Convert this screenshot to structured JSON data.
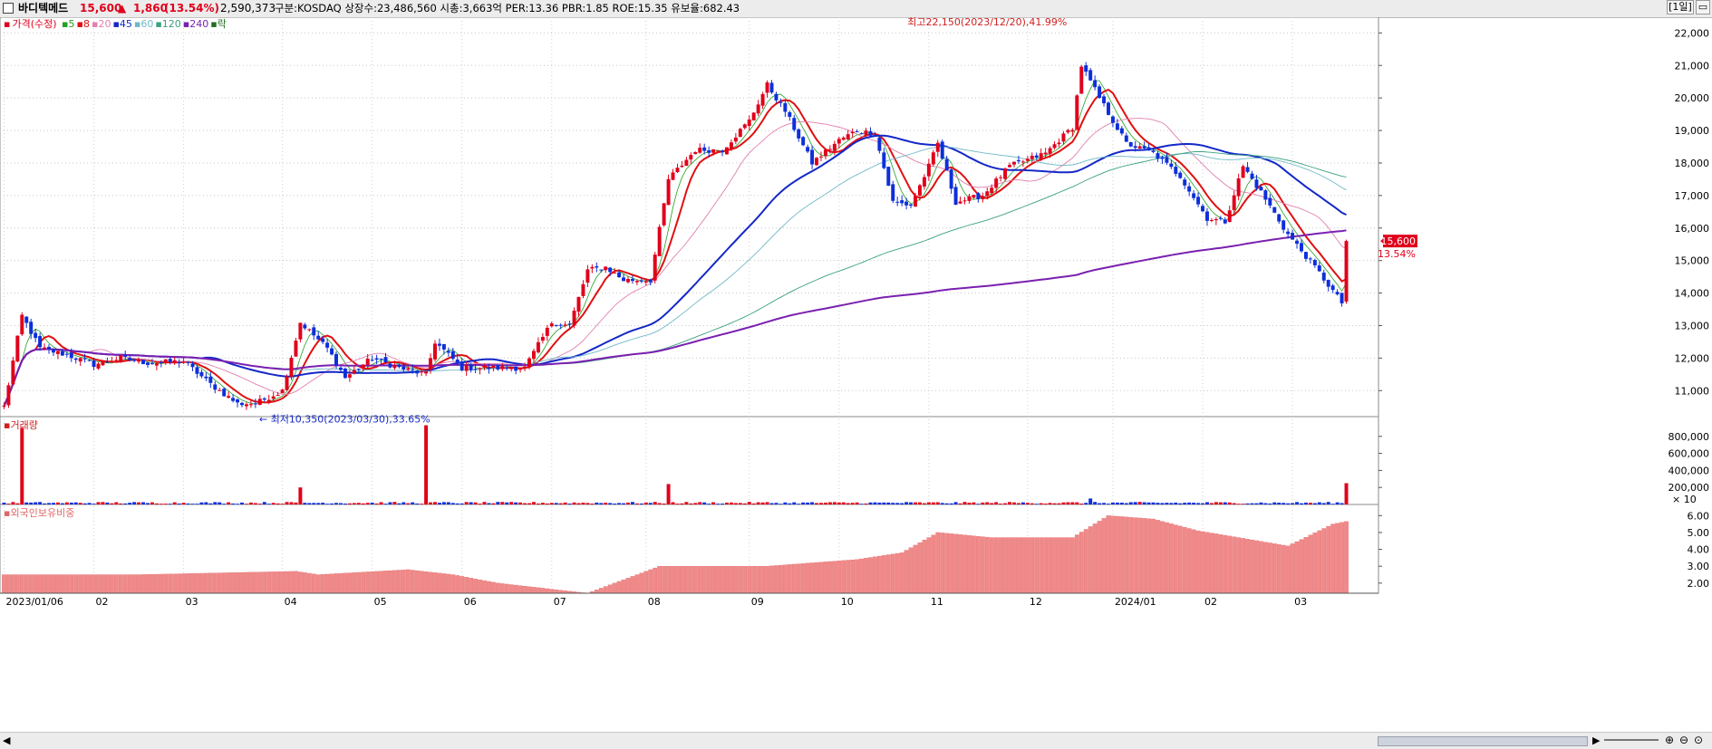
{
  "header": {
    "stock_name": "바디텍메드",
    "price": "15,600",
    "change_arrow": "▲",
    "change": "1,860",
    "change_pct": "(13.54%)",
    "volume": "2,590,373",
    "info": "구분:KOSDAQ 상장수:23,486,560 시총:3,663억 PER:13.36 PBR:1.85 ROE:15.35 유보율:682.43",
    "period_button": "[1일]",
    "up_color": "#e0001b",
    "down_color": "#0d2fd9"
  },
  "legend": {
    "price_label": "가격(수정)",
    "ma": [
      {
        "label": "5",
        "color": "#22a022"
      },
      {
        "label": "8",
        "color": "#e01010"
      },
      {
        "label": "20",
        "color": "#e080b0"
      },
      {
        "label": "45",
        "color": "#1428c8"
      },
      {
        "label": "60",
        "color": "#70b8c8"
      },
      {
        "label": "120",
        "color": "#3aa080"
      },
      {
        "label": "240",
        "color": "#7a20b0"
      },
      {
        "label": "락",
        "color": "#207020"
      }
    ]
  },
  "annotations": {
    "high": "최고22,150(2023/12/20),41.99%",
    "low": "최저10,350(2023/03/30),33.65%"
  },
  "current_price": {
    "label": "15,600",
    "pct": "13.54%"
  },
  "volume_panel": {
    "label": "거래량",
    "unit": "× 10"
  },
  "foreign_panel": {
    "label": "외국인보유비중"
  },
  "chart_data": [
    {
      "type": "candlestick",
      "title": "",
      "y_ticks": [
        "22,000",
        "21,000",
        "20,000",
        "19,000",
        "18,000",
        "17,000",
        "16,000",
        "15,000",
        "14,000",
        "13,000",
        "12,000",
        "11,000"
      ],
      "ylim": [
        10200,
        22400
      ],
      "x_ticks": [
        "2023/01/06",
        "02",
        "03",
        "04",
        "05",
        "06",
        "07",
        "08",
        "09",
        "10",
        "11",
        "12",
        "2024/01",
        "02",
        "03"
      ],
      "x_tick_index": [
        0,
        20,
        40,
        62,
        82,
        102,
        122,
        143,
        166,
        186,
        206,
        228,
        247,
        267,
        287
      ],
      "n_bars": 300,
      "waypoints": [
        [
          0,
          10500
        ],
        [
          4,
          13300
        ],
        [
          8,
          12300
        ],
        [
          14,
          12100
        ],
        [
          20,
          11800
        ],
        [
          26,
          12000
        ],
        [
          32,
          11850
        ],
        [
          40,
          11900
        ],
        [
          46,
          11200
        ],
        [
          52,
          10600
        ],
        [
          56,
          10600
        ],
        [
          62,
          11000
        ],
        [
          66,
          13100
        ],
        [
          72,
          12300
        ],
        [
          76,
          11400
        ],
        [
          82,
          12000
        ],
        [
          88,
          11700
        ],
        [
          94,
          11500
        ],
        [
          96,
          12500
        ],
        [
          102,
          11700
        ],
        [
          110,
          11700
        ],
        [
          116,
          11700
        ],
        [
          122,
          13100
        ],
        [
          126,
          13000
        ],
        [
          130,
          14700
        ],
        [
          134,
          14800
        ],
        [
          138,
          14400
        ],
        [
          144,
          14400
        ],
        [
          148,
          17500
        ],
        [
          154,
          18400
        ],
        [
          160,
          18400
        ],
        [
          166,
          19300
        ],
        [
          170,
          20400
        ],
        [
          174,
          19600
        ],
        [
          180,
          18000
        ],
        [
          186,
          18700
        ],
        [
          190,
          19000
        ],
        [
          194,
          18900
        ],
        [
          198,
          16800
        ],
        [
          202,
          16700
        ],
        [
          206,
          17900
        ],
        [
          208,
          18600
        ],
        [
          212,
          16800
        ],
        [
          218,
          17000
        ],
        [
          224,
          17900
        ],
        [
          232,
          18300
        ],
        [
          238,
          19100
        ],
        [
          240,
          21000
        ],
        [
          244,
          20000
        ],
        [
          250,
          18600
        ],
        [
          256,
          18300
        ],
        [
          262,
          17600
        ],
        [
          268,
          16300
        ],
        [
          272,
          16200
        ],
        [
          276,
          17900
        ],
        [
          280,
          17100
        ],
        [
          286,
          15800
        ],
        [
          292,
          14800
        ],
        [
          298,
          13700
        ],
        [
          299,
          15600
        ]
      ],
      "volume_ticks": [
        "800,000",
        "600,000",
        "400,000",
        "200,000"
      ],
      "volume_spikes": [
        [
          4,
          900000
        ],
        [
          66,
          200000
        ],
        [
          94,
          930000
        ],
        [
          148,
          240000
        ],
        [
          242,
          70000
        ],
        [
          299,
          250000
        ]
      ],
      "foreign_holding_ticks": [
        "6.00",
        "5.00",
        "4.00",
        "3.00",
        "2.00"
      ],
      "foreign_holding_range": [
        1.4,
        6.5
      ],
      "foreign_holding_waypoints": [
        [
          0,
          2.5
        ],
        [
          30,
          2.5
        ],
        [
          65,
          2.7
        ],
        [
          70,
          2.5
        ],
        [
          90,
          2.8
        ],
        [
          100,
          2.5
        ],
        [
          110,
          2.0
        ],
        [
          130,
          1.4
        ],
        [
          146,
          3.0
        ],
        [
          170,
          3.0
        ],
        [
          190,
          3.4
        ],
        [
          200,
          3.8
        ],
        [
          208,
          5.0
        ],
        [
          220,
          4.7
        ],
        [
          238,
          4.7
        ],
        [
          246,
          6.0
        ],
        [
          256,
          5.8
        ],
        [
          266,
          5.1
        ],
        [
          275,
          4.7
        ],
        [
          286,
          4.2
        ],
        [
          296,
          5.5
        ],
        [
          300,
          5.7
        ]
      ]
    }
  ]
}
